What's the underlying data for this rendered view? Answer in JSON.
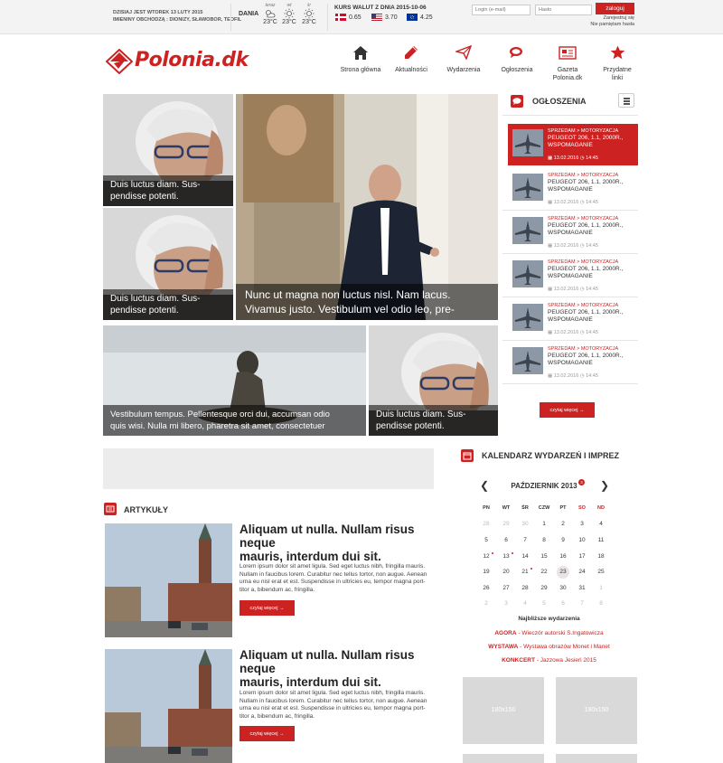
{
  "topbar": {
    "date_line1": "DZISIAJ JEST WTOREK 13 LUTY 2015",
    "date_line2": "IMIENINY OBCHODZĄ : DIONIZY, SŁAWOBOR, TEOFIL",
    "country": "DANIA",
    "weather": [
      {
        "day": "teraz",
        "temp": "23°C",
        "icon": "cloud-sun-icon"
      },
      {
        "day": "wt",
        "temp": "23°C",
        "icon": "sun-icon"
      },
      {
        "day": "śr",
        "temp": "23°C",
        "icon": "sun-icon"
      }
    ],
    "fx_title": "KURS WALUT Z DNIA 2015-10-06",
    "fx": [
      {
        "currency": "DKK",
        "value": "0.65"
      },
      {
        "currency": "USD",
        "value": "3.70"
      },
      {
        "currency": "EUR",
        "value": "4.25"
      }
    ],
    "login_placeholder": "Login (e-mail)",
    "password_placeholder": "Hasło",
    "login_button": "zaloguj",
    "register_link": "Zarejestruj się",
    "forgot_link": "Nie pamiętam hasła"
  },
  "header": {
    "logo_text": "Polonia.dk",
    "nav": [
      {
        "label": "Strona główna",
        "icon": "home-icon"
      },
      {
        "label": "Aktualności",
        "icon": "pencil-icon"
      },
      {
        "label": "Wydarzenia",
        "icon": "paper-plane-icon"
      },
      {
        "label": "Ogłoszenia",
        "icon": "chat-bubbles-icon"
      },
      {
        "label": "Gazeta\nPolonia.dk",
        "icon": "newspaper-icon"
      },
      {
        "label": "Przydatne\nlinki",
        "icon": "star-icon"
      }
    ]
  },
  "hero": {
    "tiles": [
      {
        "caption": "Duis luctus diam. Sus-\npendisse potenti."
      },
      {
        "caption": "Duis luctus diam. Sus-\npendisse potenti."
      },
      {
        "caption": "Nunc ut magna non luctus nisl. Nam lacus.\nVivamus justo. Vestibulum vel odio leo, pre-"
      },
      {
        "caption": "Vestibulum tempus. Pellentesque orci dui, accumsan odio\nquis wisi. Nulla mi libero, pharetra sit amet, consectetuer"
      },
      {
        "caption": "Duis luctus diam. Sus-\npendisse potenti."
      }
    ]
  },
  "ads": {
    "title": "OGŁOSZENIA",
    "items": [
      {
        "category": "SPRZEDAM > MOTORYZACJA",
        "title": "PEUGEOT 206, 1.1, 2000R.,\nWSPOMAGANIE",
        "date": "13.02.2016",
        "time": "14:45"
      },
      {
        "category": "SPRZEDAM > MOTORYZACJA",
        "title": "PEUGEOT 206, 1.1, 2000R.,\nWSPOMAGANIE",
        "date": "13.02.2016",
        "time": "14:45"
      },
      {
        "category": "SPRZEDAM > MOTORYZACJA",
        "title": "PEUGEOT 206, 1.1, 2000R.,\nWSPOMAGANIE",
        "date": "13.02.2016",
        "time": "14:45"
      },
      {
        "category": "SPRZEDAM > MOTORYZACJA",
        "title": "PEUGEOT 206, 1.1, 2000R.,\nWSPOMAGANIE",
        "date": "13.02.2016",
        "time": "14:45"
      },
      {
        "category": "SPRZEDAM > MOTORYZACJA",
        "title": "PEUGEOT 206, 1.1, 2000R.,\nWSPOMAGANIE",
        "date": "13.02.2016",
        "time": "14:45"
      },
      {
        "category": "SPRZEDAM > MOTORYZACJA",
        "title": "PEUGEOT 206, 1.1, 2000R.,\nWSPOMAGANIE",
        "date": "13.02.2016",
        "time": "14:45"
      }
    ],
    "more_button": "czytaj więcej →"
  },
  "articles": {
    "title": "ARTYKUŁY",
    "items": [
      {
        "title": "Aliquam ut nulla. Nullam risus neque\nmauris, interdum dui sit.",
        "body": "Lorem ipsum dolor sit amet ligula. Sed eget luctus nibh, fringilla mauris.\nNullam in faucibus lorem. Curabitur nec tellus tortor, non augue. Aenean\nurna eu nisl erat et est. Suspendisse in ultricies eu, tempor magna port-\ntitor a, bibendum ac, fringilla.",
        "more": "czytaj więcej →"
      },
      {
        "title": "Aliquam ut nulla. Nullam risus neque\nmauris, interdum dui sit.",
        "body": "Lorem ipsum dolor sit amet ligula. Sed eget luctus nibh, fringilla mauris.\nNullam in faucibus lorem. Curabitur nec tellus tortor, non augue. Aenean\nurna eu nisl erat et est. Suspendisse in ultricies eu, tempor magna port-\ntitor a, bibendum ac, fringilla.",
        "more": "czytaj więcej →"
      }
    ]
  },
  "calendar": {
    "title": "KALENDARZ WYDARZEŃ I IMPREZ",
    "month": "PAŹDZIERNIK 2013",
    "badge": "3",
    "weekdays": [
      "PN",
      "WT",
      "ŚR",
      "CZW",
      "PT",
      "SO",
      "ND"
    ],
    "weeks": [
      [
        "28",
        "29",
        "30",
        "1",
        "2",
        "3",
        "4"
      ],
      [
        "5",
        "6",
        "7",
        "8",
        "9",
        "10",
        "11"
      ],
      [
        "12",
        "13",
        "14",
        "15",
        "16",
        "17",
        "18"
      ],
      [
        "19",
        "20",
        "21",
        "22",
        "23",
        "24",
        "25"
      ],
      [
        "26",
        "27",
        "28",
        "29",
        "30",
        "31",
        "1"
      ],
      [
        "2",
        "3",
        "4",
        "5",
        "6",
        "7",
        "8"
      ]
    ],
    "today": "23",
    "events_title": "Najbliższe wydarzenia",
    "events": [
      {
        "place": "AGORA",
        "text": " - Wieczór autorski S.Ingatowicza"
      },
      {
        "place": "WYSTAWA",
        "text": " - Wystawa obrazów Monet i Manet"
      },
      {
        "place": "KONKCERT",
        "text": " - Jazzowa Jesień 2015"
      }
    ],
    "placeholders": [
      "180x150",
      "180x150"
    ]
  },
  "colors": {
    "accent": "#cc2222",
    "caption_bg": "rgba(0,0,0,0.55)"
  }
}
